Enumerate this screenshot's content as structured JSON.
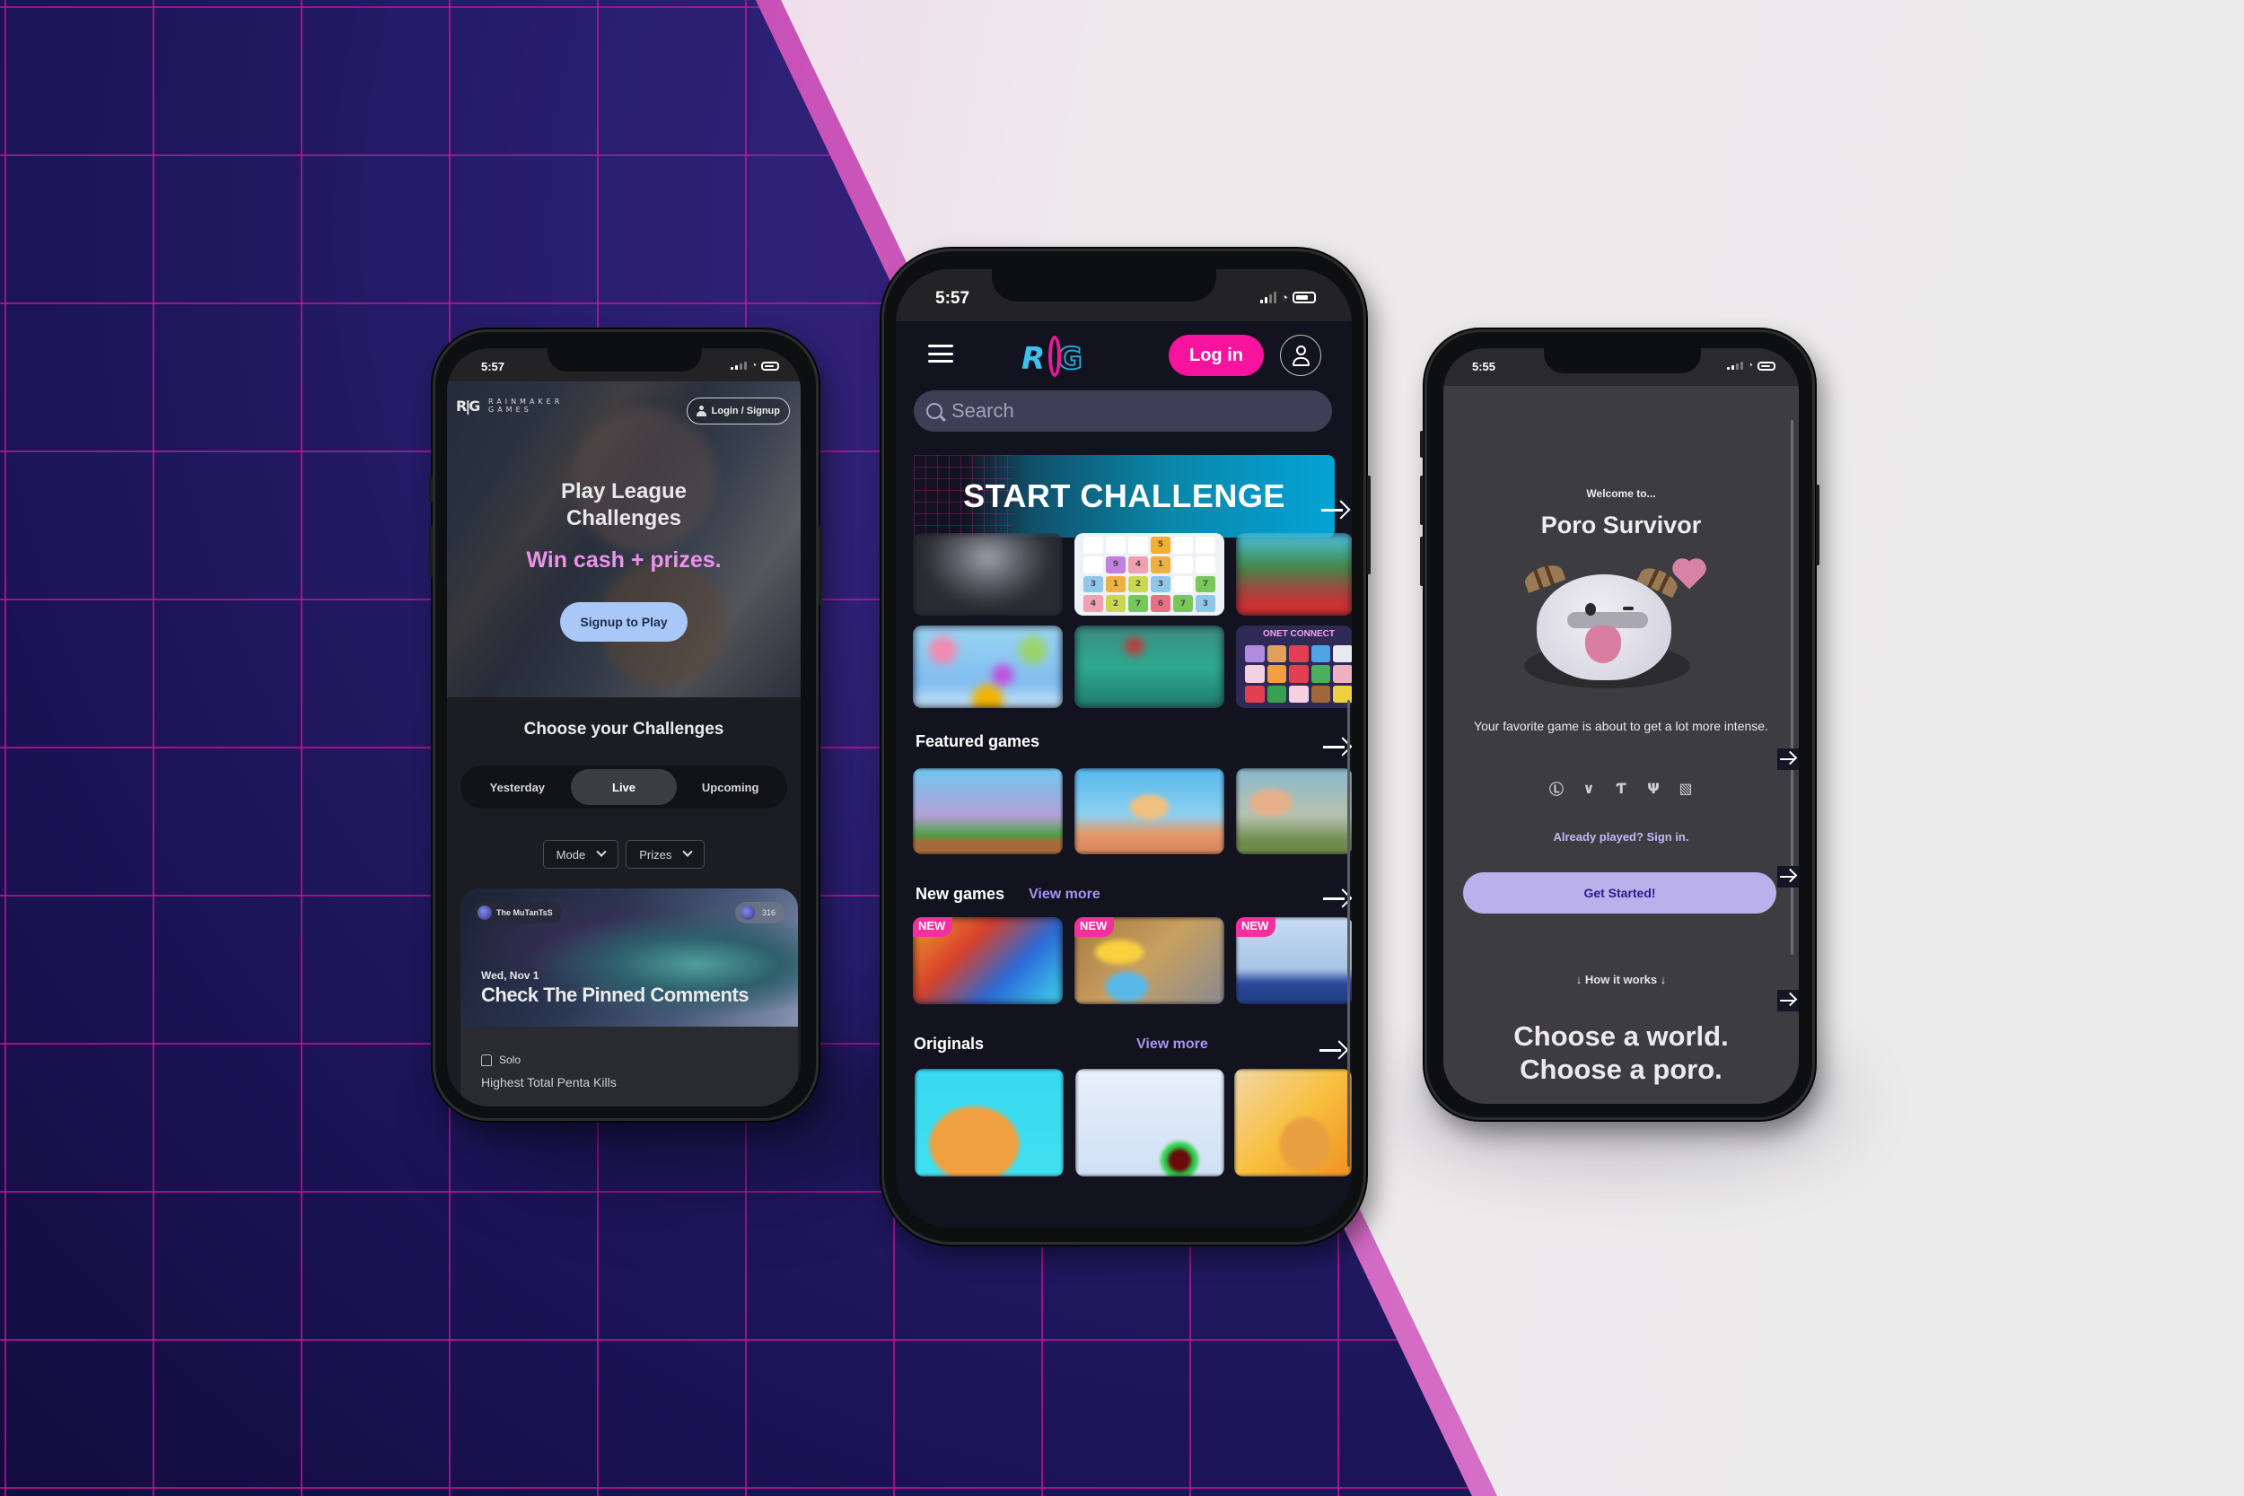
{
  "background": {
    "dark_color": "#2c1f72",
    "grid_color": "#c4149c",
    "light_color": "#ebebeb",
    "accent_pink": "#e27ad2"
  },
  "phone_left": {
    "status": {
      "time": "5:57"
    },
    "brand": {
      "mark": "R|G",
      "line1": "RAINMAKER",
      "line2": "GAMES"
    },
    "login_signup_label": "Login / Signup",
    "hero": {
      "title_line1": "Play League",
      "title_line2": "Challenges",
      "subtitle": "Win cash + prizes.",
      "cta_label": "Signup to Play"
    },
    "section_title": "Choose your Challenges",
    "tabs": [
      {
        "label": "Yesterday",
        "active": false
      },
      {
        "label": "Live",
        "active": true
      },
      {
        "label": "Upcoming",
        "active": false
      }
    ],
    "filters": [
      {
        "label": "Mode"
      },
      {
        "label": "Prizes"
      }
    ],
    "challenge_card": {
      "team": "The MuTanTsS",
      "count": "316",
      "date": "Wed, Nov 1",
      "title": "Check The Pinned Comments",
      "mode": "Solo",
      "description": "Highest Total Penta Kills"
    }
  },
  "phone_mid": {
    "status": {
      "time": "5:57"
    },
    "header": {
      "logo": "RG",
      "login_label": "Log in"
    },
    "search": {
      "placeholder": "Search",
      "value": ""
    },
    "banner_label": "START CHALLENGE",
    "colors": {
      "login": "#f7139e",
      "banner_end": "#04a3d6",
      "view_more": "#a694f2",
      "new_badge": "#f3309c"
    },
    "top_grid": {
      "number_puzzle": [
        [
          "",
          "",
          "",
          "5",
          "",
          ""
        ],
        [
          "",
          "9",
          "4",
          "1",
          "",
          ""
        ],
        [
          "3",
          "1",
          "2",
          "3",
          "",
          "7"
        ],
        [
          "4",
          "2",
          "7",
          "6",
          "7",
          "3"
        ]
      ],
      "connect_title": "ONET CONNECT"
    },
    "sections": [
      {
        "title": "Featured games",
        "view_more": ""
      },
      {
        "title": "New games",
        "view_more": "View more",
        "badge": "NEW"
      },
      {
        "title": "Originals",
        "view_more": "View more"
      }
    ]
  },
  "phone_right": {
    "status": {
      "time": "5:55"
    },
    "welcome": "Welcome to...",
    "title": "Poro Survivor",
    "tagline": "Your favorite game is about to get a lot more intense.",
    "game_icons": [
      "league-of-legends-icon",
      "valorant-icon",
      "tft-icon",
      "destiny-icon",
      "dota-icon"
    ],
    "game_icon_glyphs": [
      "Ⓛ",
      "∨",
      "Ƭ",
      "Ψ",
      "▧"
    ],
    "signin_label": "Already played? Sign in.",
    "cta_label": "Get Started!",
    "how_it_works": "↓ How it works ↓",
    "bottom_line1": "Choose a world.",
    "bottom_line2": "Choose a poro."
  }
}
